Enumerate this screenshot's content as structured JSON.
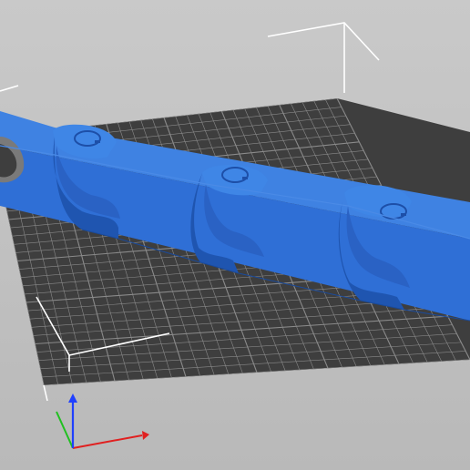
{
  "app": {
    "view": "3d-print-preview"
  },
  "scene": {
    "object": "chain-link-model",
    "links": 4,
    "colors": {
      "background": "#bdbdbd",
      "bed": "#3e3e3e",
      "grid_line": "#8a8a8a",
      "model": "#2f6fd6",
      "model_shadow": "#1f4fa3",
      "model_highlight": "#4a8ae6",
      "build_volume": "#ffffff",
      "axis_x": "#e02020",
      "axis_y": "#20c020",
      "axis_z": "#2040ff"
    },
    "icons": {
      "axis_gizmo": "axes-icon",
      "volume_corner": "corner-bracket-icon"
    }
  }
}
